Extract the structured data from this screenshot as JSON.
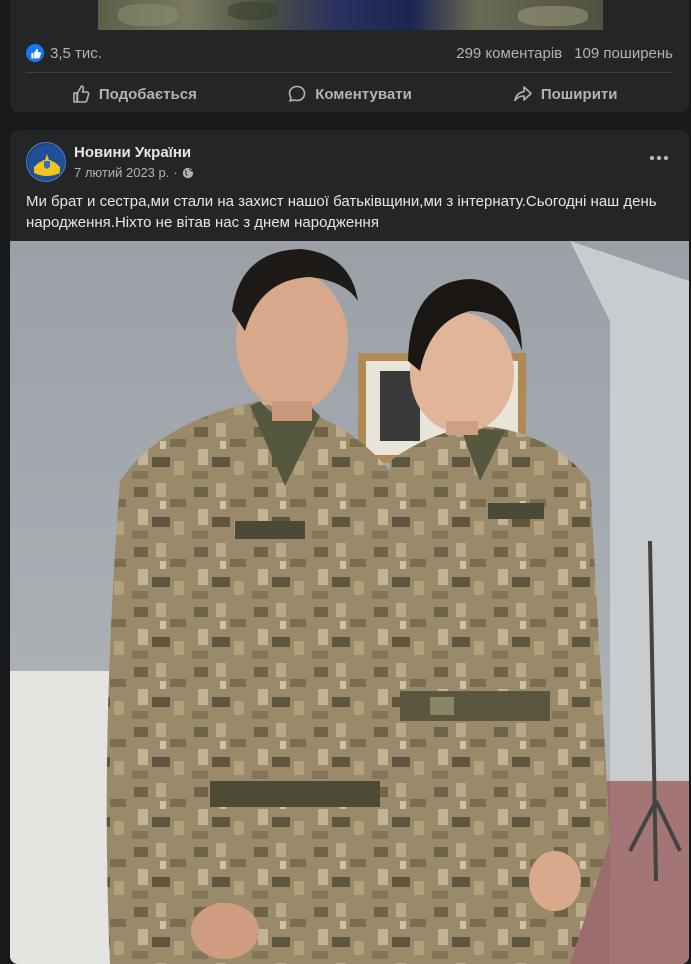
{
  "prev_post": {
    "reactions_count": "3,5 тис.",
    "comments": "299 коментарів",
    "shares": "109 поширень",
    "actions": {
      "like": "Подобається",
      "comment": "Коментувати",
      "share": "Поширити"
    }
  },
  "post": {
    "page_name": "Новини України",
    "date": "7 лютий 2023 р.",
    "separator": "·",
    "text": "Ми брат и сестра,ми стали на захист нашої батьківщини,ми з інтернату.Сьогодні наш день народження.Ніхто не вітав нас з днем народження"
  },
  "icons": {
    "like_badge": "thumbs-up-icon",
    "privacy": "globe-icon",
    "more": "more-horizontal-icon"
  },
  "colors": {
    "accent": "#1877f2",
    "card": "#242526",
    "background": "#18191a"
  }
}
